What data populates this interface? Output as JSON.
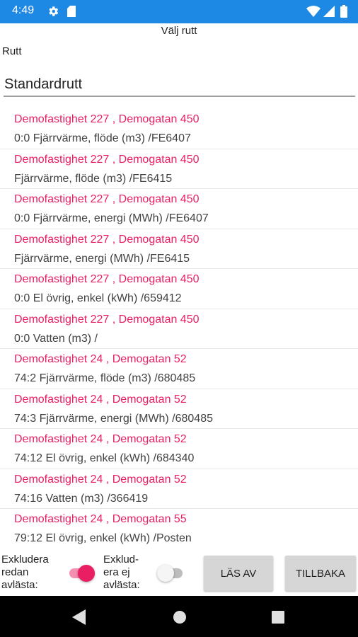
{
  "status_bar": {
    "time": "4:49"
  },
  "page": {
    "title": "Välj rutt"
  },
  "route": {
    "label": "Rutt",
    "value": "Standardrutt"
  },
  "rows": [
    {
      "property": "Demofastighet 227 , Demogatan 450",
      "meter": "0:0 Fjärrvärme, flöde (m3) /FE6407"
    },
    {
      "property": "Demofastighet 227 , Demogatan 450",
      "meter": "Fjärrvärme, flöde (m3) /FE6415"
    },
    {
      "property": "Demofastighet 227 , Demogatan 450",
      "meter": "0:0 Fjärrvärme, energi (MWh) /FE6407"
    },
    {
      "property": "Demofastighet 227 , Demogatan 450",
      "meter": "Fjärrvärme, energi (MWh) /FE6415"
    },
    {
      "property": "Demofastighet 227 , Demogatan 450",
      "meter": "0:0 El övrig, enkel (kWh) /659412"
    },
    {
      "property": "Demofastighet 227 , Demogatan 450",
      "meter": "0:0 Vatten (m3) /"
    },
    {
      "property": "Demofastighet 24 , Demogatan 52",
      "meter": "74:2 Fjärrvärme, flöde (m3) /680485"
    },
    {
      "property": "Demofastighet 24 , Demogatan 52",
      "meter": "74:3 Fjärrvärme, energi (MWh) /680485"
    },
    {
      "property": "Demofastighet 24 , Demogatan 52",
      "meter": "74:12 El övrig, enkel (kWh) /684340"
    },
    {
      "property": "Demofastighet 24 , Demogatan 52",
      "meter": "74:16 Vatten (m3) /366419"
    },
    {
      "property": "Demofastighet 24 , Demogatan 55",
      "meter": "79:12 El övrig, enkel (kWh) /Posten"
    }
  ],
  "controls": {
    "exclude_read_label": [
      "Exkludera",
      "redan",
      "avlästa:"
    ],
    "exclude_read_on": true,
    "exclude_unread_label": [
      "Exklud-",
      "era ej",
      "avlästa:"
    ],
    "exclude_unread_on": false,
    "read_button": "LÄS AV",
    "back_button": "TILLBAKA"
  },
  "colors": {
    "status_bar": "#1e88e5",
    "accent": "#e91e63",
    "switch_track_on": "#f48fb1",
    "button_bg": "#d6d6d6"
  },
  "icons": {
    "status_left": [
      "gear-icon",
      "sd-card-icon"
    ],
    "status_right": [
      "wifi-icon",
      "signal-icon",
      "battery-icon"
    ],
    "nav": [
      "back-icon",
      "home-icon",
      "recents-icon"
    ]
  }
}
